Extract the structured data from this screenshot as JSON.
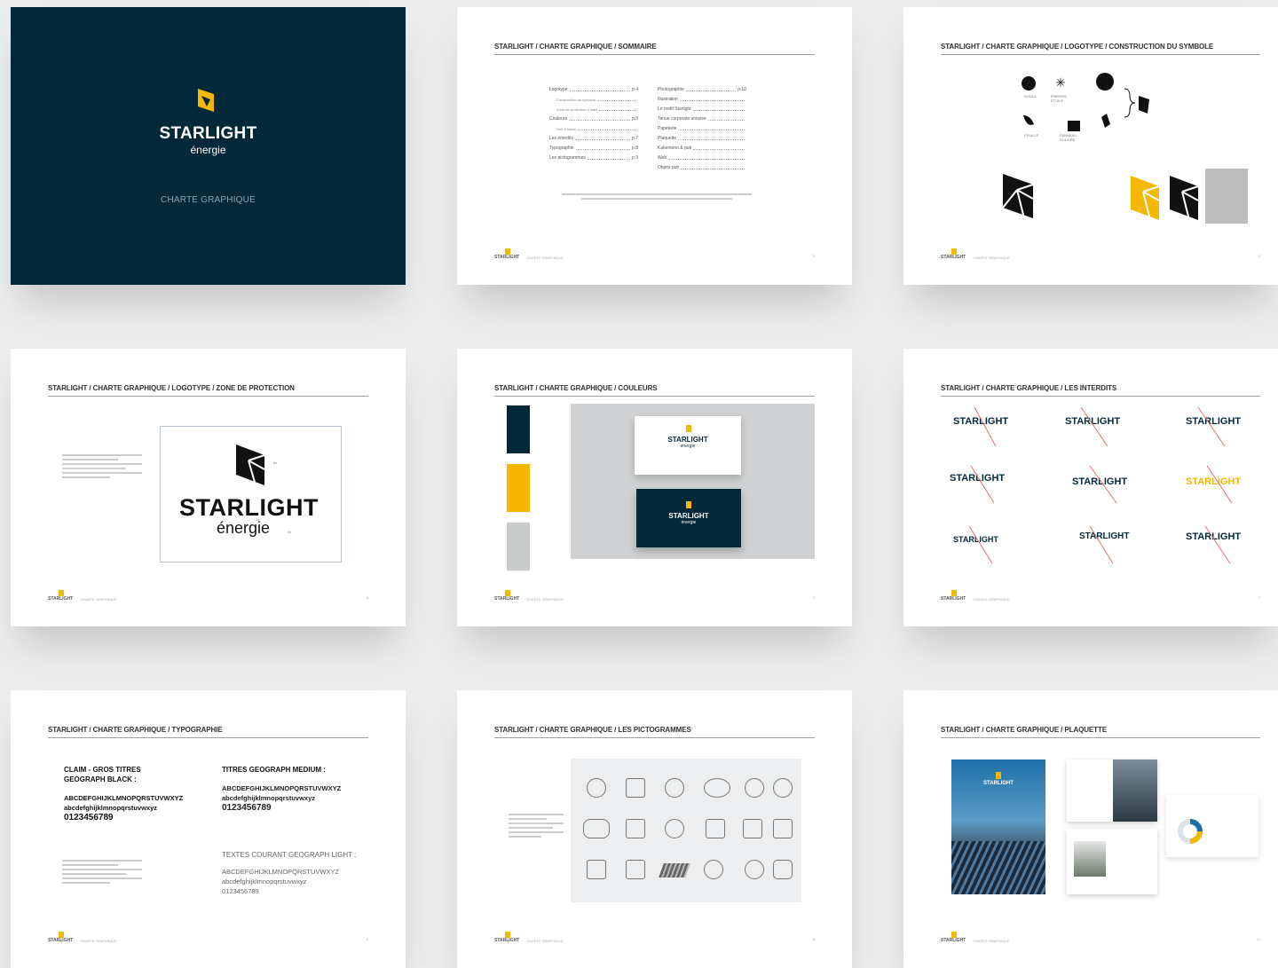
{
  "brand": {
    "name": "STARLIGHT",
    "sub": "énergie"
  },
  "cover": {
    "title": "CHARTE GRAPHIQUE"
  },
  "footer": {
    "label": "CHARTE GRAPHIQUE"
  },
  "colors": {
    "navy": "#03283a",
    "yellow": "#f5b800",
    "grey": "#c8c9c9",
    "black": "#111111"
  },
  "pages": [
    {
      "header": "STARLIGHT / CHARTE GRAPHIQUE / SOMMAIRE",
      "num": "2"
    },
    {
      "header": "STARLIGHT / CHARTE GRAPHIQUE / LOGOTYPE / CONSTRUCTION DU SYMBOLE",
      "num": "3"
    },
    {
      "header": "STARLIGHT / CHARTE GRAPHIQUE / LOGOTYPE / ZONE DE PROTECTION",
      "num": "4"
    },
    {
      "header": "STARLIGHT / CHARTE GRAPHIQUE / COULEURS",
      "num": "5"
    },
    {
      "header": "STARLIGHT / CHARTE GRAPHIQUE / LES INTERDITS",
      "num": "7"
    },
    {
      "header": "STARLIGHT / CHARTE GRAPHIQUE / TYPOGRAPHIE",
      "num": "8"
    },
    {
      "header": "STARLIGHT / CHARTE GRAPHIQUE / LES PICTOGRAMMES",
      "num": "9"
    },
    {
      "header": "STARLIGHT / CHARTE GRAPHIQUE / PLAQUETTE",
      "num": "11"
    }
  ],
  "toc": {
    "left": [
      "Logotype",
      "Construction du symbole",
      "Zone de protection & taille",
      "Couleurs",
      "Noir & blanc",
      "Les interdits",
      "Typographie",
      "Les pictogrammes"
    ],
    "right": [
      "Photographie",
      "Illustration",
      "Le motif Starlight",
      "Tenue corporate unisexe",
      "Papeterie",
      "Plaquette",
      "Kakemono & pub",
      "Web",
      "Objets pub"
    ]
  },
  "symbol": {
    "labels": [
      "SOLEIL",
      "ÉNERGIE ÉTOILE",
      "FEUILLE",
      "PANNEAU SOLAIRE"
    ]
  },
  "protection": {
    "word": "STARLIGHT",
    "sub": "énergie",
    "mark1": "2x",
    "mark2": "2x",
    "mark3": "8x"
  },
  "typography": {
    "black_title": "CLAIM - GROS TITRES GEOGRAPH BLACK :",
    "medium_title": "TITRES GEOGRAPH MEDIUM :",
    "light_title": "TEXTES COURANT GEOGRAPH LIGHT :",
    "upper": "ABCDEFGHIJKLMNOPQRSTUVWXYZ",
    "lower": "abcdefghijklmnopqrstuvwxyz",
    "digits": "0123456789"
  }
}
